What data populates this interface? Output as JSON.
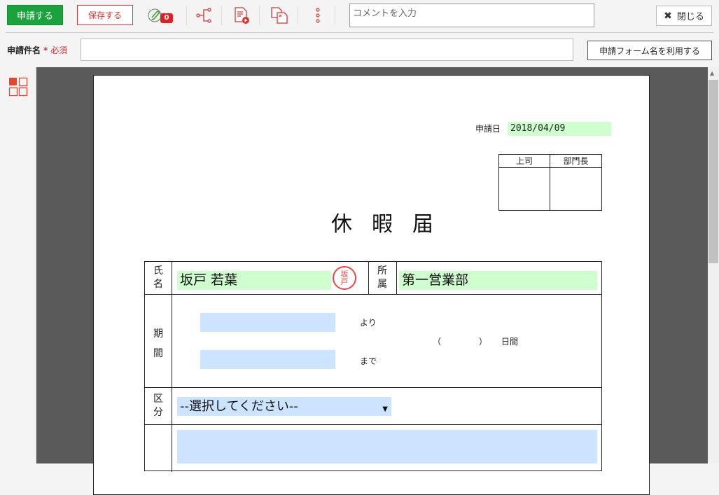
{
  "toolbar": {
    "apply_label": "申請する",
    "save_label": "保存する",
    "attachment_count": "0",
    "comment_placeholder": "コメントを入力",
    "close_label": "閉じる"
  },
  "subject": {
    "label": "申請件名",
    "required_mark": "*",
    "required_text": "必須",
    "input_value": "",
    "use_form_name_label": "申請フォーム名を利用する"
  },
  "form": {
    "date_label": "申請日",
    "date_value": "2018/04/09",
    "approvers": [
      "上司",
      "部門長"
    ],
    "title": "休暇届",
    "name_label_1": "氏",
    "name_label_2": "名",
    "name_value": "坂戸 若葉",
    "hanko_text": "坂戸",
    "dept_label_1": "所",
    "dept_label_2": "属",
    "dept_value": "第一営業部",
    "period_label_1": "期",
    "period_label_2": "間",
    "from_suffix": "より",
    "to_suffix": "まで",
    "days_open": "（",
    "days_close": "）",
    "days_unit": "日間",
    "category_label_1": "区",
    "category_label_2": "分",
    "category_selected": "--選択してください--"
  },
  "colors": {
    "apply_green": "#1aa33c",
    "save_red": "#dd3333",
    "field_green": "#cfffcf",
    "field_blue": "#cce4ff",
    "viewer_gray": "#5a5a5a"
  },
  "icons": [
    "attachment-icon",
    "route-icon",
    "preview-icon",
    "copy-icon",
    "more-icon",
    "close-icon",
    "layout-icon"
  ]
}
